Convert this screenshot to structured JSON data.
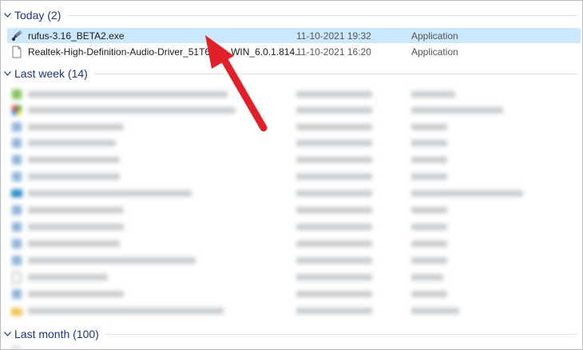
{
  "groups": {
    "today": {
      "label": "Today (2)"
    },
    "last_week": {
      "label": "Last week (14)"
    },
    "last_month": {
      "label": "Last month (100)"
    }
  },
  "today_files": [
    {
      "name": "rufus-3.16_BETA2.exe",
      "date": "11-10-2021 19:32",
      "type": "Application",
      "icon": "rufus-app-icon"
    },
    {
      "name": "Realtek-High-Definition-Audio-Driver_51T6",
      "name_tail": "WIN_6.0.1.814...",
      "date": "11-10-2021 16:20",
      "type": "Application",
      "icon": "generic-file-icon"
    }
  ],
  "colors": {
    "group_header": "#1e3287",
    "selection": "#cce8ff",
    "arrow": "#e2202a"
  }
}
